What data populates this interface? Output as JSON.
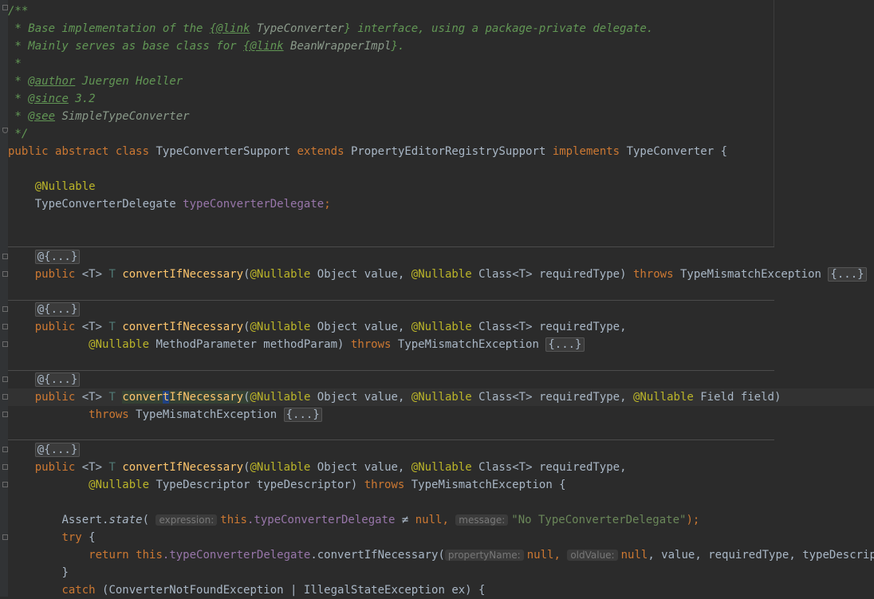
{
  "doc": {
    "open": "/**",
    "l1_a": " * Base implementation of the ",
    "l1_link": "{@link",
    "l1_ref": " TypeConverter",
    "l1_b": "} interface, using a package-private delegate.",
    "l2_a": " * Mainly serves as base class for ",
    "l2_link": "{@link",
    "l2_ref": " BeanWrapperImpl",
    "l2_b": "}.",
    "l3": " *",
    "author_tag": "@author",
    "author_prefix": " * ",
    "author_val": " Juergen Hoeller",
    "since_tag": "@since",
    "since_val": " 3.2",
    "see_tag": "@see",
    "see_val": " SimpleTypeConverter",
    "close": " */"
  },
  "class_decl": {
    "public": "public",
    "abstract": "abstract",
    "class": "class",
    "name": "TypeConverterSupport",
    "extends": "extends",
    "parent": "PropertyEditorRegistrySupport",
    "implements": "implements",
    "iface": "TypeConverter",
    "brace": " {"
  },
  "field": {
    "annotation": "@Nullable",
    "type": "TypeConverterDelegate",
    "name": "typeConverterDelegate",
    "semi": ";"
  },
  "fold_ann": "@{...}",
  "fold_body": "{...}",
  "m1": {
    "public": "public",
    "generic": "<T>",
    "ret": "T",
    "name": "convertIfNecessary",
    "paren": "(",
    "ann1": "@Nullable",
    "p1": " Object value, ",
    "ann2": "@Nullable",
    "p2": " Class<T> requiredType) ",
    "throws": "throws",
    "exc": " TypeMismatchException "
  },
  "m2": {
    "public": "public",
    "generic": "<T>",
    "ret": "T",
    "name": "convertIfNecessary",
    "paren": "(",
    "ann1": "@Nullable",
    "p1": " Object value, ",
    "ann2": "@Nullable",
    "p2": " Class<T> requiredType,",
    "ann3": "@Nullable",
    "p3": " MethodParameter methodParam) ",
    "throws": "throws",
    "exc": " TypeMismatchException "
  },
  "m3": {
    "public": "public",
    "generic": "<T>",
    "ret": "T",
    "name_a": "conver",
    "name_sel": "t",
    "name_b": "IfNecessary",
    "paren": "(",
    "ann1": "@Nullable",
    "p1": " Object value, ",
    "ann2": "@Nullable",
    "p2": " Class<T> requiredType, ",
    "ann3": "@Nullable",
    "p3": " Field field)",
    "throws": "throws",
    "exc": " TypeMismatchException "
  },
  "m4": {
    "public": "public",
    "generic": "<T>",
    "ret": "T",
    "name": "convertIfNecessary",
    "paren": "(",
    "ann1": "@Nullable",
    "p1": " Object value, ",
    "ann2": "@Nullable",
    "p2": " Class<T> requiredType,",
    "ann3": "@Nullable",
    "p3": " TypeDescriptor typeDescriptor) ",
    "throws": "throws",
    "exc": " TypeMismatchException {"
  },
  "body": {
    "assert_a": "Assert.",
    "assert_fn": "state",
    "assert_paren": "(",
    "hint_expr": "expression:",
    "this": "this",
    "dot_field": ".typeConverterDelegate",
    "neq": " ≠ ",
    "null": "null",
    "comma": ", ",
    "hint_msg": "message:",
    "msg": "\"No TypeConverterDelegate\"",
    "end": ");",
    "try": "try",
    "brace_open": " {",
    "return": "return",
    "this2": "this",
    "ret_field": ".typeConverterDelegate",
    "ret_call": ".convertIfNecessary(",
    "hint_prop": "propertyName:",
    "null2": "null",
    "comma2": ", ",
    "hint_old": "oldValue:",
    "null3": "null",
    "rest": ", value, requiredType, typeDescriptor);",
    "close_brace": "}",
    "catch": "catch",
    "catch_rest": " (ConverterNotFoundException | IllegalStateException ex) {"
  }
}
